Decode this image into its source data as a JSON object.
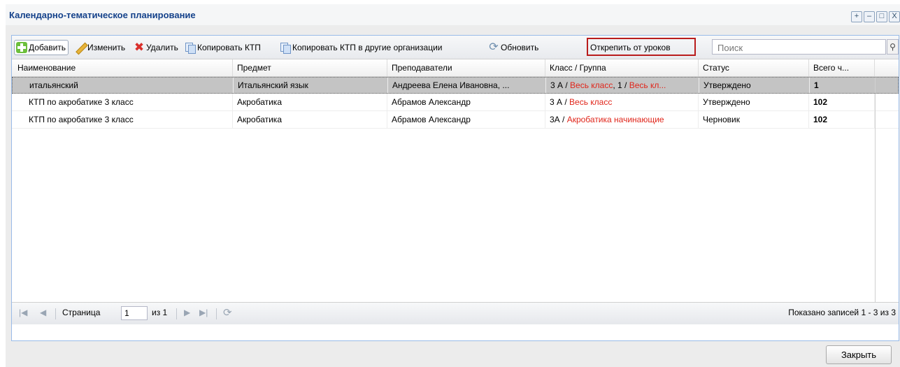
{
  "window": {
    "title": "Календарно-тематическое планирование",
    "buttons": [
      "+",
      "–",
      "□",
      "X"
    ]
  },
  "toolbar": {
    "add": "Добавить",
    "edit": "Изменить",
    "delete": "Удалить",
    "copy": "Копировать КТП",
    "copy_other": "Копировать КТП в другие организации",
    "refresh": "Обновить",
    "unlink": "Открепить от уроков",
    "search_placeholder": "Поиск"
  },
  "columns": [
    "Наименование",
    "Предмет",
    "Преподаватели",
    "Класс / Группа",
    "Статус",
    "Всего ч..."
  ],
  "rows": [
    {
      "name": "итальянский",
      "subject": "Итальянский язык",
      "teachers": "Андреева Елена Ивановна, ...",
      "class_a": "3 А",
      "class_sep1": " / ",
      "group_a": "Весь класс",
      "class_b": ", 1",
      "class_sep2": " / ",
      "group_b": "Весь кл...",
      "status": "Утверждено",
      "total": "1",
      "selected": true
    },
    {
      "name": "КТП по акробатике 3 класс",
      "subject": "Акробатика",
      "teachers": "Абрамов Александр",
      "class_a": "3 А",
      "class_sep1": " / ",
      "group_a": "Весь класс",
      "status": "Утверждено",
      "total": "102"
    },
    {
      "name": "КТП по акробатике 3 класс",
      "subject": "Акробатика",
      "teachers": "Абрамов Александр",
      "class_a": "3А",
      "class_sep1": " / ",
      "group_a": "Акробатика начинающие",
      "status": "Черновик",
      "total": "102"
    }
  ],
  "pager": {
    "page_label": "Страница",
    "page_value": "1",
    "of_label": "из 1",
    "summary": "Показано записей 1 - 3 из 3"
  },
  "footer": {
    "close": "Закрыть"
  },
  "colors": {
    "highlight_border": "#b91c1c",
    "group_text": "#e0261b",
    "title_text": "#15428b"
  },
  "icons": [
    "plus-icon",
    "pencil-icon",
    "delete-x-icon",
    "copy-icon",
    "refresh-icon",
    "search-icon",
    "first-page-icon",
    "prev-page-icon",
    "next-page-icon",
    "last-page-icon"
  ]
}
